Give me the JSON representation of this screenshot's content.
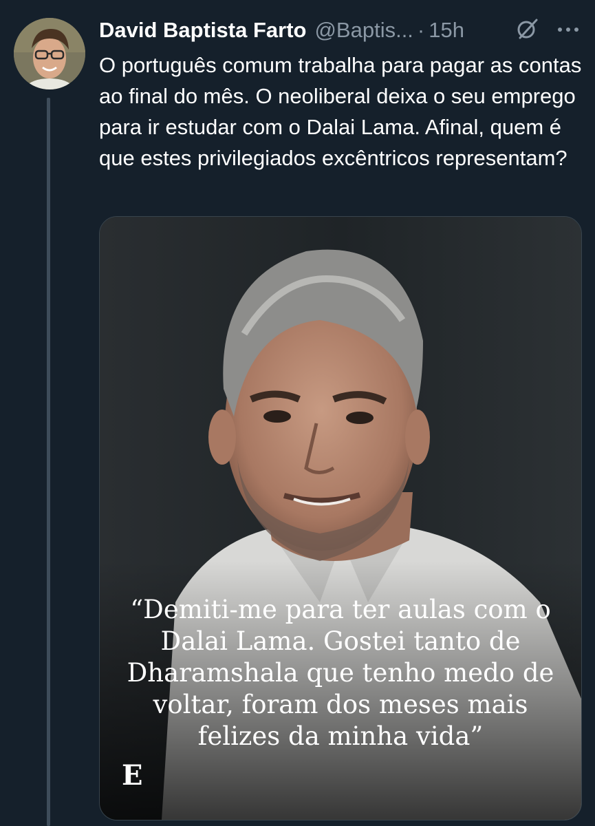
{
  "author": {
    "name": "David Baptista Farto",
    "handle": "@Baptis...",
    "separator": "·",
    "time": "15h"
  },
  "tweet": {
    "text": "O português comum trabalha para pagar as contas ao final do mês. O neoliberal deixa o seu emprego para ir estudar com o Dalai Lama. Afinal, quem é que estes privilegiados excêntricos representam?"
  },
  "media": {
    "quote": "“Demiti-me para ter aulas com o Dalai Lama. Gostei tanto de Dharamshala que tenho medo de voltar, foram dos meses mais felizes da minha vida”",
    "brand_mark": "E"
  },
  "icons": {
    "grok": "grok-icon",
    "more": "more-icon"
  },
  "colors": {
    "background": "#15202b",
    "secondary_text": "#8b98a5",
    "thread_line": "#3e4c5a",
    "border": "#38444d"
  }
}
